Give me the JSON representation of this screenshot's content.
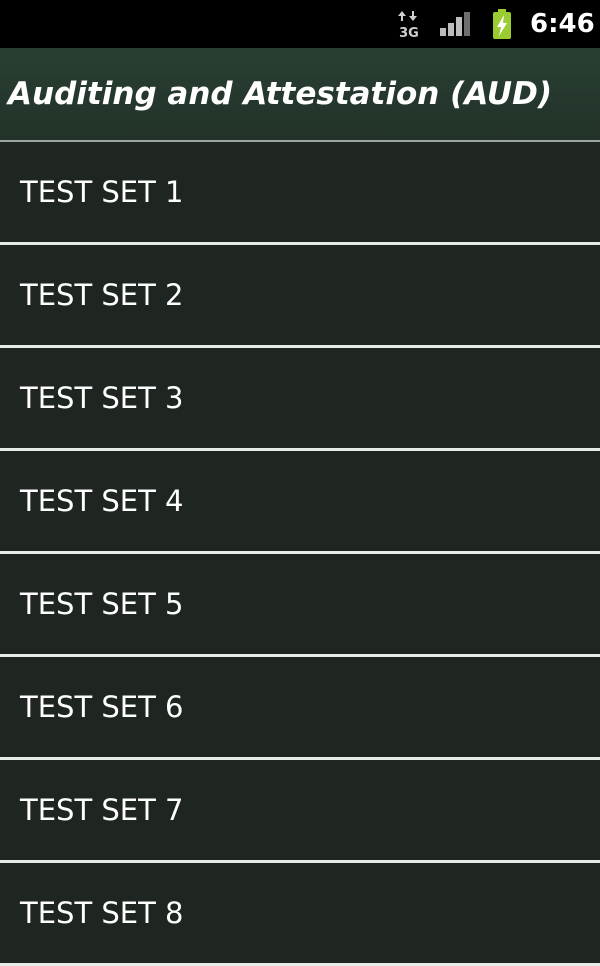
{
  "status_bar": {
    "time": "6:46",
    "network_label": "3G",
    "icons": [
      "data-transfer-icon",
      "signal-strength-icon",
      "battery-charging-icon"
    ],
    "background": "#000000"
  },
  "header": {
    "title": "Auditing and Attestation (AUD)",
    "background": "#263a2e"
  },
  "list": {
    "items": [
      {
        "label": "TEST SET 1"
      },
      {
        "label": "TEST SET 2"
      },
      {
        "label": "TEST SET 3"
      },
      {
        "label": "TEST SET 4"
      },
      {
        "label": "TEST SET 5"
      },
      {
        "label": "TEST SET 6"
      },
      {
        "label": "TEST SET 7"
      },
      {
        "label": "TEST SET 8"
      }
    ],
    "divider_color": "#e6ebe6",
    "item_background": "#1f2621"
  }
}
